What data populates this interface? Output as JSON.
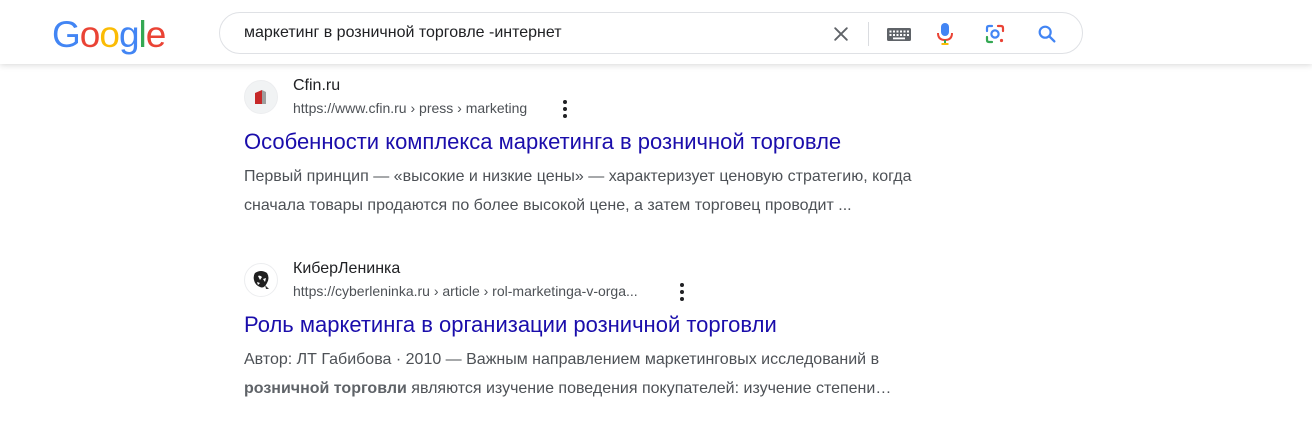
{
  "header": {
    "logo": {
      "letters": [
        "G",
        "o",
        "o",
        "g",
        "l",
        "e"
      ],
      "colors": [
        "#4285F4",
        "#EA4335",
        "#FBBC05",
        "#4285F4",
        "#34A853",
        "#EA4335"
      ]
    },
    "search": {
      "query": "маркетинг в розничной торговле -интернет"
    },
    "icons": [
      "close-icon",
      "keyboard-icon",
      "microphone-icon",
      "lens-icon",
      "search-icon"
    ]
  },
  "results": [
    {
      "site_name": "Cfin.ru",
      "url": "https://www.cfin.ru › press › marketing",
      "title": "Особенности комплекса маркетинга в розничной торговле",
      "snippet_line1": "Первый принцип — «высокие и низкие цены» — характеризует ценовую стратегию, когда",
      "snippet_line2": "сначала товары продаются по более высокой цене, а затем торговец проводит ..."
    },
    {
      "site_name": "КиберЛенинка",
      "url": "https://cyberleninka.ru › article › rol-marketinga-v-orga...",
      "title": "Роль маркетинга в организации розничной торговли",
      "snippet_line1": "Автор: ЛТ Габибова · 2010 — Важным направлением маркетинговых исследований в",
      "snippet_bold": "розничной торговли",
      "snippet_line2_rest": " являются изучение поведения покупателей: изучение степени…"
    }
  ],
  "colors": {
    "link": "#1a0dab",
    "snippet": "#4d5156",
    "mic_blue": "#4285F4",
    "mic_red": "#EA4335",
    "search_blue": "#4285F4"
  }
}
